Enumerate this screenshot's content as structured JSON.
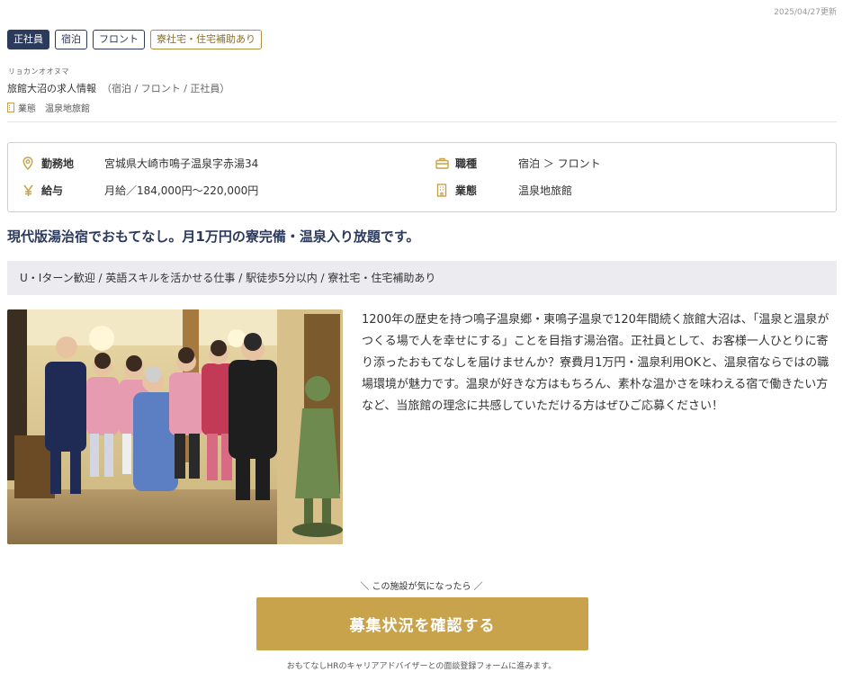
{
  "updated": "2025/04/27更新",
  "tags": [
    {
      "label": "正社員"
    },
    {
      "label": "宿泊"
    },
    {
      "label": "フロント"
    },
    {
      "label": "寮社宅・住宅補助あり"
    }
  ],
  "company": {
    "kana": "リョカンオオヌマ",
    "title": "旅館大沼の求人情報",
    "subtitle": "（宿泊 / フロント / 正社員）",
    "industry": "業態　温泉地旅館"
  },
  "info": {
    "location_label": "勤務地",
    "location_value": "宮城県大崎市鳴子温泉字赤湯34",
    "job_label": "職種",
    "job_value": "宿泊 ＞ フロント",
    "salary_label": "給与",
    "salary_value": "月給／184,000円〜220,000円",
    "business_label": "業態",
    "business_value": "温泉地旅館"
  },
  "headline": "現代版湯治宿でおもてなし。月1万円の寮完備・温泉入り放題です。",
  "features": "U・Iターン歓迎 / 英語スキルを活かせる仕事 / 駅徒歩5分以内 / 寮社宅・住宅補助あり",
  "description": "1200年の歴史を持つ鳴子温泉郷・東鳴子温泉で120年間続く旅館大沼は、「温泉と温泉がつくる場で人を幸せにする」ことを目指す湯治宿。正社員として、お客様一人ひとりに寄り添ったおもてなしを届けませんか？寮費月1万円・温泉利用OKと、温泉宿ならではの職場環境が魅力です。温泉が好きな方はもちろん、素朴な温かさを味わえる宿で働きたい方など、当旅館の理念に共感していただける方はぜひご応募ください！",
  "cta": {
    "hint": "＼ この施設が気になったら ／",
    "button": "募集状況を確認する",
    "note": "おもてなしHRのキャリアアドバイザーとの面談登録フォームに進みます。"
  },
  "colors": {
    "navy": "#2c3a5c",
    "gold": "#c9a24c",
    "feature_bg": "#ececf0"
  },
  "icons": [
    "location-pin-icon",
    "briefcase-icon",
    "yen-icon",
    "building-icon"
  ]
}
